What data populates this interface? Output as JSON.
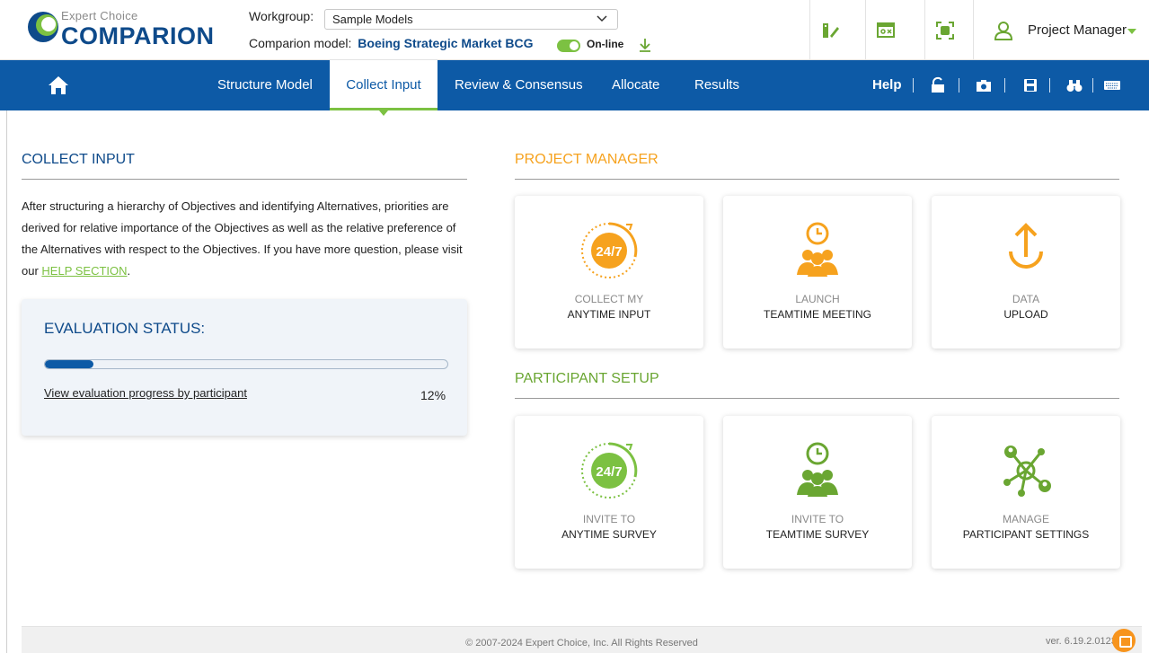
{
  "logo": {
    "sub": "Expert Choice",
    "main": "COMPARION"
  },
  "workgroup": {
    "label": "Workgroup:",
    "value": "Sample Models"
  },
  "model": {
    "label": "Comparion model:",
    "name": "Boeing Strategic Market BCG",
    "status": "On-line"
  },
  "user": {
    "name": "Project Manager"
  },
  "nav": {
    "items": [
      "Structure Model",
      "Collect Input",
      "Review & Consensus",
      "Allocate",
      "Results"
    ],
    "help": "Help"
  },
  "collect": {
    "title": "COLLECT INPUT",
    "intro": "After structuring a hierarchy of Objectives and identifying Alternatives, priorities are derived for relative importance of the Objectives as well as the relative preference of the Alternatives with respect to the Objectives. If you have more question, please visit our ",
    "help_link": "HELP SECTION",
    "intro_end": "."
  },
  "evaluation": {
    "title": "EVALUATION STATUS:",
    "link": "View evaluation progress by participant",
    "percent": 12,
    "percent_label": "12%"
  },
  "pm": {
    "title": "PROJECT MANAGER",
    "cards": [
      {
        "l1": "COLLECT MY",
        "l2": "ANYTIME INPUT",
        "icon": "anytime-24-7-icon"
      },
      {
        "l1": "LAUNCH",
        "l2": "TEAMTIME MEETING",
        "icon": "teamtime-clock-people-icon"
      },
      {
        "l1": "DATA",
        "l2": "UPLOAD",
        "icon": "upload-arrow-icon"
      }
    ]
  },
  "participant": {
    "title": "PARTICIPANT SETUP",
    "cards": [
      {
        "l1": "INVITE TO",
        "l2": "ANYTIME SURVEY",
        "icon": "anytime-24-7-icon"
      },
      {
        "l1": "INVITE TO",
        "l2": "TEAMTIME SURVEY",
        "icon": "teamtime-clock-people-icon"
      },
      {
        "l1": "MANAGE",
        "l2": "PARTICIPANT SETTINGS",
        "icon": "participant-network-icon"
      }
    ]
  },
  "footer": {
    "copyright": "© 2007-2024 Expert Choice, Inc. All Rights Reserved",
    "version": "ver. 6.19.2.01232"
  },
  "colors": {
    "navy": "#0d5aa6",
    "green": "#7cc142",
    "orange": "#f6a21e",
    "participant_green": "#6aa632"
  }
}
